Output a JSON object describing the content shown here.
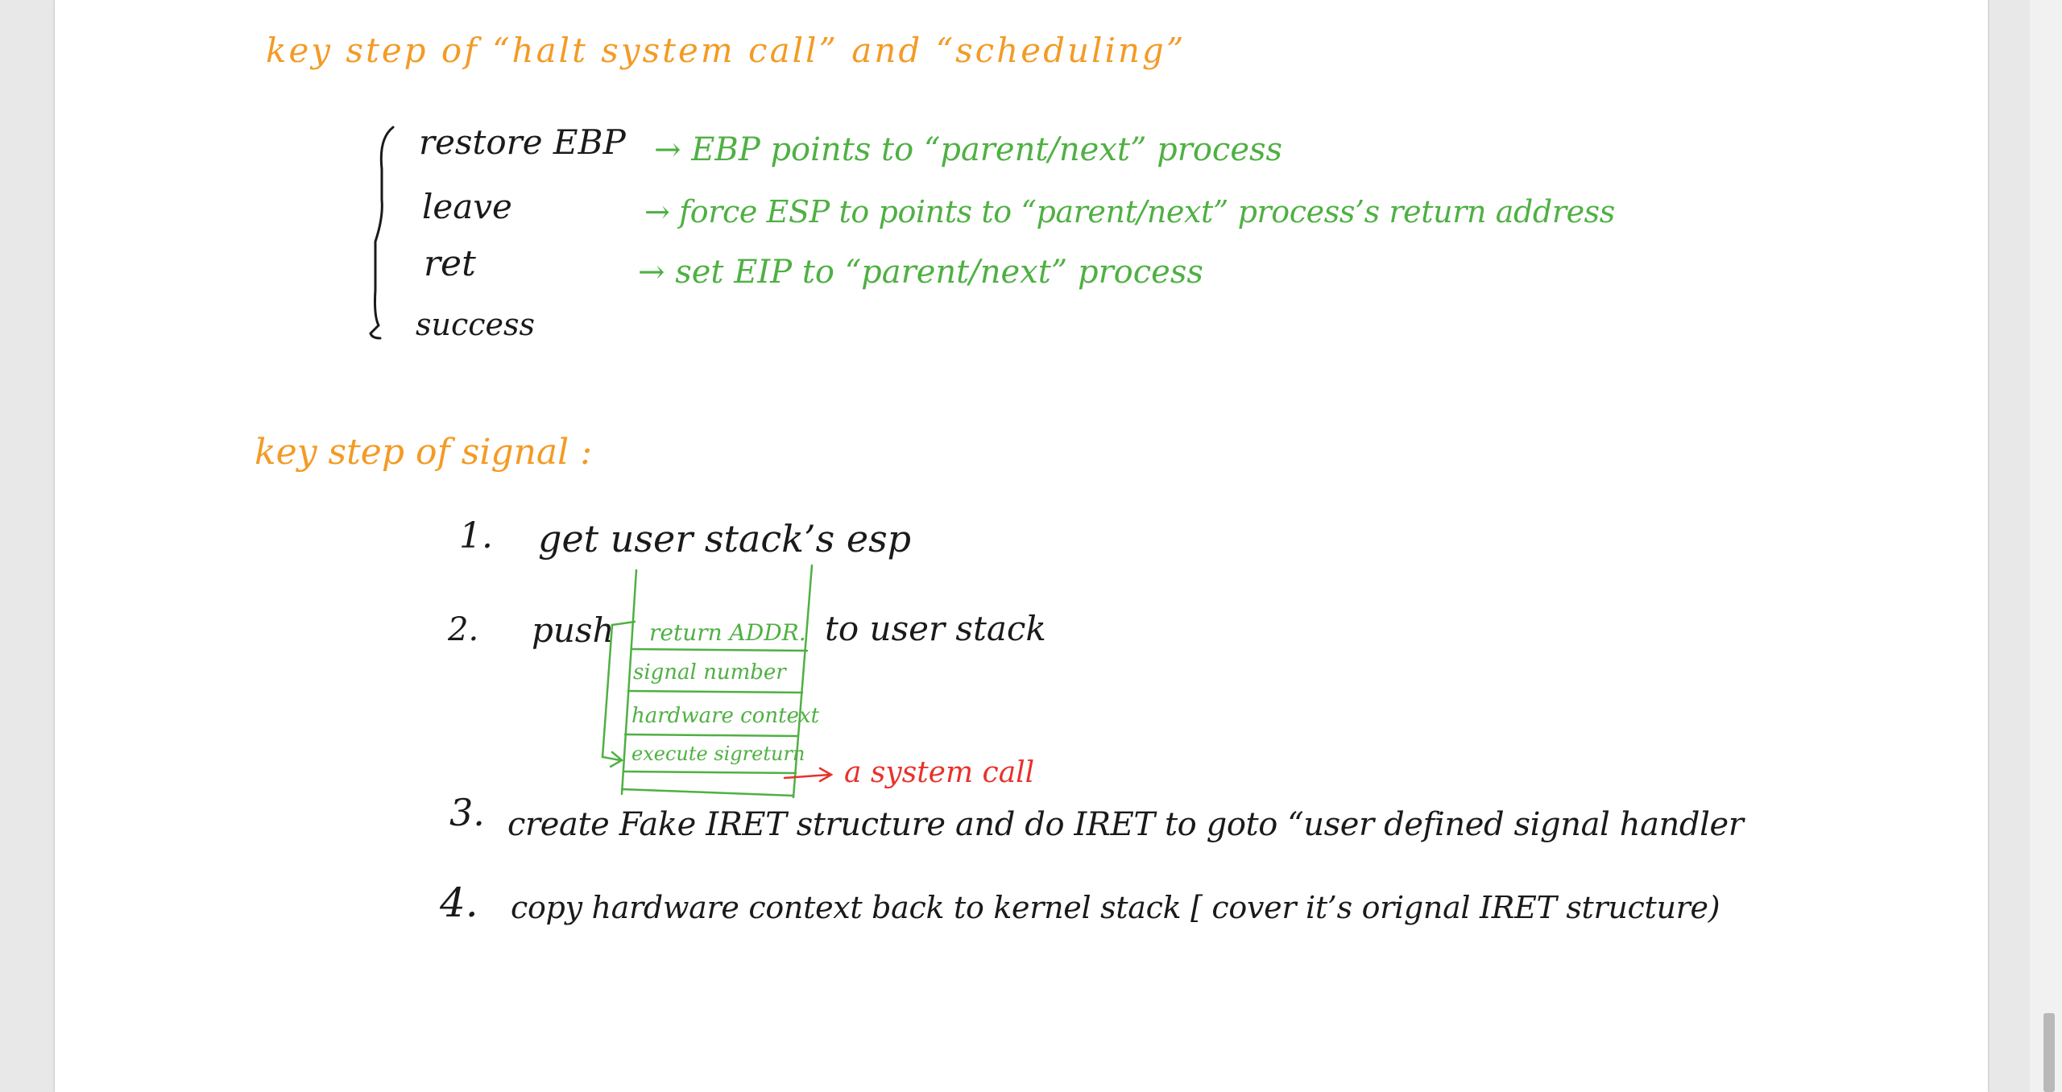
{
  "section1": {
    "heading": "key  step  of “halt system call”  and “scheduling”",
    "steps": [
      {
        "instruction": "restore EBP",
        "note": "→ EBP points to “parent/next” process"
      },
      {
        "instruction": "leave",
        "note": "→ force ESP to points to “parent/next” process’s return address"
      },
      {
        "instruction": "ret",
        "note": "→ set EIP to “parent/next” process"
      },
      {
        "instruction": "success",
        "note": ""
      }
    ]
  },
  "section2": {
    "heading": "key step of  signal :",
    "step1": {
      "num": "1.",
      "text": "get  user  stack’s  esp"
    },
    "step2": {
      "num": "2.",
      "push": "push",
      "to_stack": "to  user  stack",
      "stack_cells": [
        "return ADDR.",
        "signal number",
        "hardware context",
        "execute sigreturn"
      ],
      "annotation": "a system call"
    },
    "step3": {
      "num": "3.",
      "text": "create  Fake  IRET  structure  and  do  IRET  to  goto “user defined  signal  handler"
    },
    "step4": {
      "num": "4.",
      "text": "copy  hardware  context  back to  kernel stack [ cover it’s orignal IRET structure)"
    }
  },
  "colors": {
    "heading": "#f39b25",
    "body_text": "#1a1a1a",
    "notes": "#4fb043",
    "annotation": "#e8312c"
  }
}
